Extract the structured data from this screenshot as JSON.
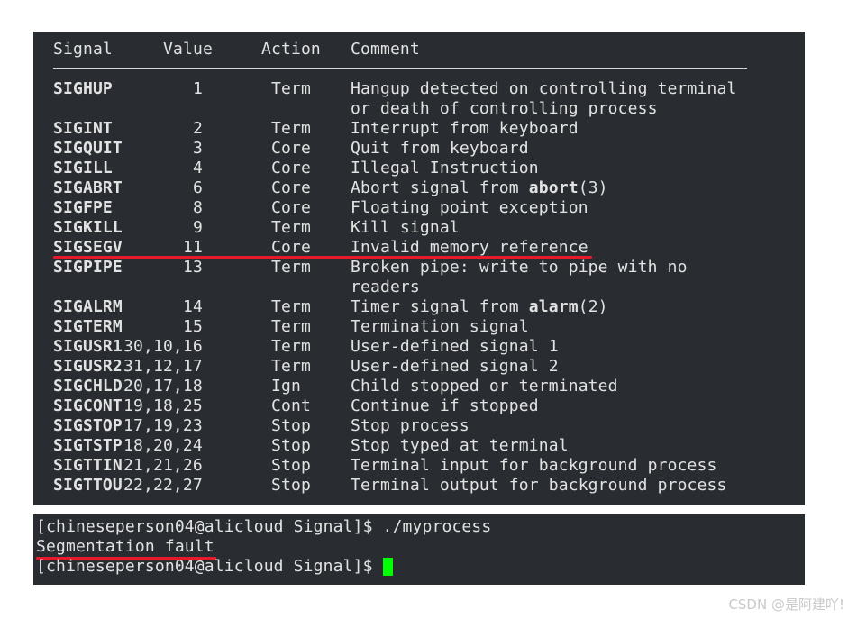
{
  "table": {
    "headers": {
      "signal": "Signal",
      "value": "Value",
      "action": "Action",
      "comment": "Comment"
    },
    "rows": [
      {
        "signal": "SIGHUP",
        "value": "1",
        "action": "Term",
        "comment": [
          [
            {
              "t": "Hangup detected on controlling terminal"
            }
          ],
          [
            {
              "t": "or death of controlling process"
            }
          ]
        ]
      },
      {
        "signal": "SIGINT",
        "value": "2",
        "action": "Term",
        "comment": [
          [
            {
              "t": "Interrupt from keyboard"
            }
          ]
        ]
      },
      {
        "signal": "SIGQUIT",
        "value": "3",
        "action": "Core",
        "comment": [
          [
            {
              "t": "Quit from keyboard"
            }
          ]
        ]
      },
      {
        "signal": "SIGILL",
        "value": "4",
        "action": "Core",
        "comment": [
          [
            {
              "t": "Illegal Instruction"
            }
          ]
        ]
      },
      {
        "signal": "SIGABRT",
        "value": "6",
        "action": "Core",
        "comment": [
          [
            {
              "t": "Abort signal from "
            },
            {
              "t": "abort",
              "bold": true
            },
            {
              "t": "(3)"
            }
          ]
        ]
      },
      {
        "signal": "SIGFPE",
        "value": "8",
        "action": "Core",
        "comment": [
          [
            {
              "t": "Floating point exception"
            }
          ]
        ]
      },
      {
        "signal": "SIGKILL",
        "value": "9",
        "action": "Term",
        "comment": [
          [
            {
              "t": "Kill signal"
            }
          ]
        ]
      },
      {
        "signal": "SIGSEGV",
        "value": "11",
        "action": "Core",
        "comment": [
          [
            {
              "t": "Invalid memory reference"
            }
          ]
        ],
        "highlighted": true
      },
      {
        "signal": "SIGPIPE",
        "value": "13",
        "action": "Term",
        "comment": [
          [
            {
              "t": "Broken pipe: write to pipe with no"
            }
          ],
          [
            {
              "t": "readers"
            }
          ]
        ]
      },
      {
        "signal": "SIGALRM",
        "value": "14",
        "action": "Term",
        "comment": [
          [
            {
              "t": "Timer signal from "
            },
            {
              "t": "alarm",
              "bold": true
            },
            {
              "t": "(2)"
            }
          ]
        ]
      },
      {
        "signal": "SIGTERM",
        "value": "15",
        "action": "Term",
        "comment": [
          [
            {
              "t": "Termination signal"
            }
          ]
        ]
      },
      {
        "signal": "SIGUSR1",
        "value": "30,10,16",
        "action": "Term",
        "comment": [
          [
            {
              "t": "User-defined signal 1"
            }
          ]
        ]
      },
      {
        "signal": "SIGUSR2",
        "value": "31,12,17",
        "action": "Term",
        "comment": [
          [
            {
              "t": "User-defined signal 2"
            }
          ]
        ]
      },
      {
        "signal": "SIGCHLD",
        "value": "20,17,18",
        "action": "Ign",
        "comment": [
          [
            {
              "t": "Child stopped or terminated"
            }
          ]
        ]
      },
      {
        "signal": "SIGCONT",
        "value": "19,18,25",
        "action": "Cont",
        "comment": [
          [
            {
              "t": "Continue if stopped"
            }
          ]
        ]
      },
      {
        "signal": "SIGSTOP",
        "value": "17,19,23",
        "action": "Stop",
        "comment": [
          [
            {
              "t": "Stop process"
            }
          ]
        ]
      },
      {
        "signal": "SIGTSTP",
        "value": "18,20,24",
        "action": "Stop",
        "comment": [
          [
            {
              "t": "Stop typed at terminal"
            }
          ]
        ]
      },
      {
        "signal": "SIGTTIN",
        "value": "21,21,26",
        "action": "Stop",
        "comment": [
          [
            {
              "t": "Terminal input for background process"
            }
          ]
        ]
      },
      {
        "signal": "SIGTTOU",
        "value": "22,22,27",
        "action": "Stop",
        "comment": [
          [
            {
              "t": "Terminal output for background process"
            }
          ]
        ]
      }
    ]
  },
  "terminal": {
    "lines": [
      "[chineseperson04@alicloud Signal]$ ./myprocess",
      "Segmentation fault",
      "[chineseperson04@alicloud Signal]$ "
    ],
    "cursor_color": "#00ff00",
    "highlight_color": "#e8192c"
  },
  "watermark": "CSDN @是阿建吖!"
}
